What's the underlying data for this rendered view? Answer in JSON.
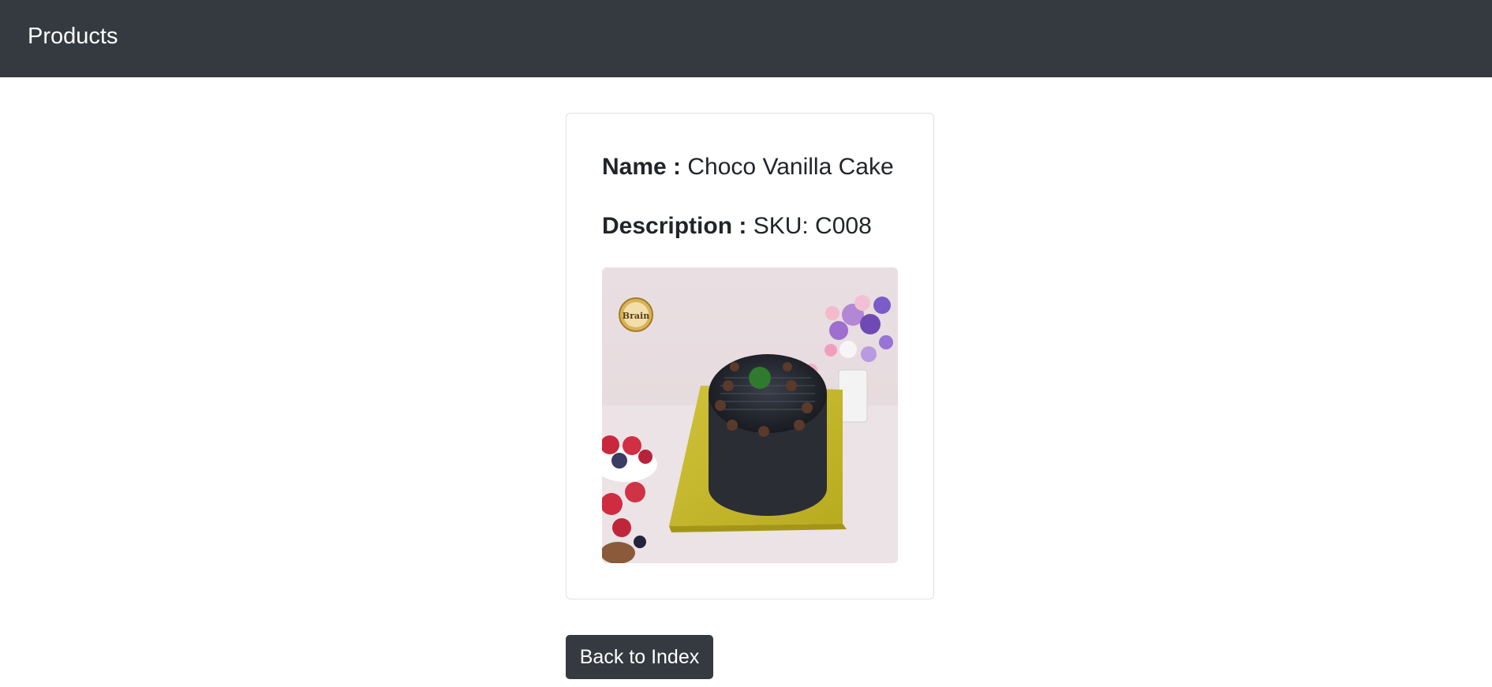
{
  "navbar": {
    "brand": "Products"
  },
  "product": {
    "name_label": "Name :",
    "name_value": "Choco Vanilla Cake",
    "description_label": "Description :",
    "description_value": "SKU: C008",
    "image": {
      "subject": "chocolate vanilla cake on yellow branded board with berries and flowers",
      "logo_text": "Brain"
    }
  },
  "actions": {
    "back_label": "Back to Index"
  },
  "colors": {
    "navbar_bg": "#343a40",
    "button_bg": "#343a40",
    "text": "#212529",
    "card_border": "#dee2e6"
  }
}
